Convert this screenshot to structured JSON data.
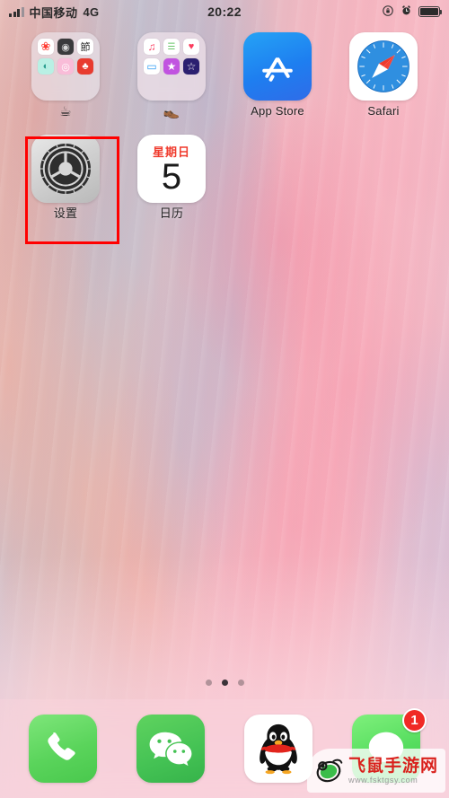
{
  "status_bar": {
    "carrier": "中国移动",
    "network_type": "4G",
    "time": "20:22",
    "signal_bars_filled": 3,
    "signal_bars_total": 4,
    "icons": [
      "rotation-lock-icon",
      "alarm-clock-icon",
      "battery-icon"
    ],
    "battery_level_percent": 85
  },
  "home_screen": {
    "rows": [
      {
        "apps": [
          {
            "label": "☕",
            "type": "folder",
            "name": "folder-one",
            "mini_apps": [
              {
                "name": "photos",
                "glyph": "❀",
                "bg": "#ffffff",
                "fg": "#ff3b30"
              },
              {
                "name": "camera",
                "glyph": "◉",
                "bg": "#3a3a3c",
                "fg": "#d8d8d8"
              },
              {
                "name": "translate",
                "glyph": "節",
                "bg": "#ffffff",
                "fg": "#2a2a2a"
              },
              {
                "name": "alipay",
                "glyph": "◐",
                "bg": "#b9f0e4",
                "fg": "#2a9d8f"
              },
              {
                "name": "instagram",
                "glyph": "◎",
                "bg": "#f9bcd8",
                "fg": "#ffffff"
              },
              {
                "name": "taobao",
                "glyph": "♣",
                "bg": "#e83b2f",
                "fg": "#ffffff"
              }
            ]
          },
          {
            "label": "👞",
            "type": "folder",
            "name": "folder-two",
            "mini_apps": [
              {
                "name": "music",
                "glyph": "♫",
                "bg": "#ffffff",
                "fg": "#fa3e60"
              },
              {
                "name": "reminders",
                "glyph": "☰",
                "bg": "#ffffff",
                "fg": "#6ac56a"
              },
              {
                "name": "health",
                "glyph": "♥",
                "bg": "#ffffff",
                "fg": "#fb3b5c"
              },
              {
                "name": "files",
                "glyph": "▭",
                "bg": "#ffffff",
                "fg": "#2f9df4"
              },
              {
                "name": "clips",
                "glyph": "★",
                "bg": "#c153e0",
                "fg": "#ffffff"
              },
              {
                "name": "imovie",
                "glyph": "☆",
                "bg": "#2b2070",
                "fg": "#ffffff"
              }
            ]
          },
          {
            "label": "App Store",
            "type": "app",
            "name": "app-store"
          },
          {
            "label": "Safari",
            "type": "app",
            "name": "safari"
          }
        ]
      },
      {
        "apps": [
          {
            "label": "设置",
            "type": "app",
            "name": "settings",
            "highlighted": true
          },
          {
            "label": "日历",
            "type": "app",
            "name": "calendar",
            "calendar": {
              "day_of_week": "星期日",
              "day_number": "5"
            }
          }
        ]
      }
    ]
  },
  "page_dots": {
    "total": 3,
    "active_index": 1
  },
  "dock": {
    "items": [
      {
        "name": "phone",
        "label": "Phone",
        "badge": null
      },
      {
        "name": "wechat",
        "label": "WeChat",
        "badge": null
      },
      {
        "name": "qq",
        "label": "QQ",
        "badge": null
      },
      {
        "name": "messages",
        "label": "Messages",
        "badge": "1"
      }
    ]
  },
  "highlight": {
    "color": "#ff0000",
    "target": "settings"
  },
  "watermark": {
    "title": "飞鼠手游网",
    "url": "www.fsktgsy.com"
  }
}
